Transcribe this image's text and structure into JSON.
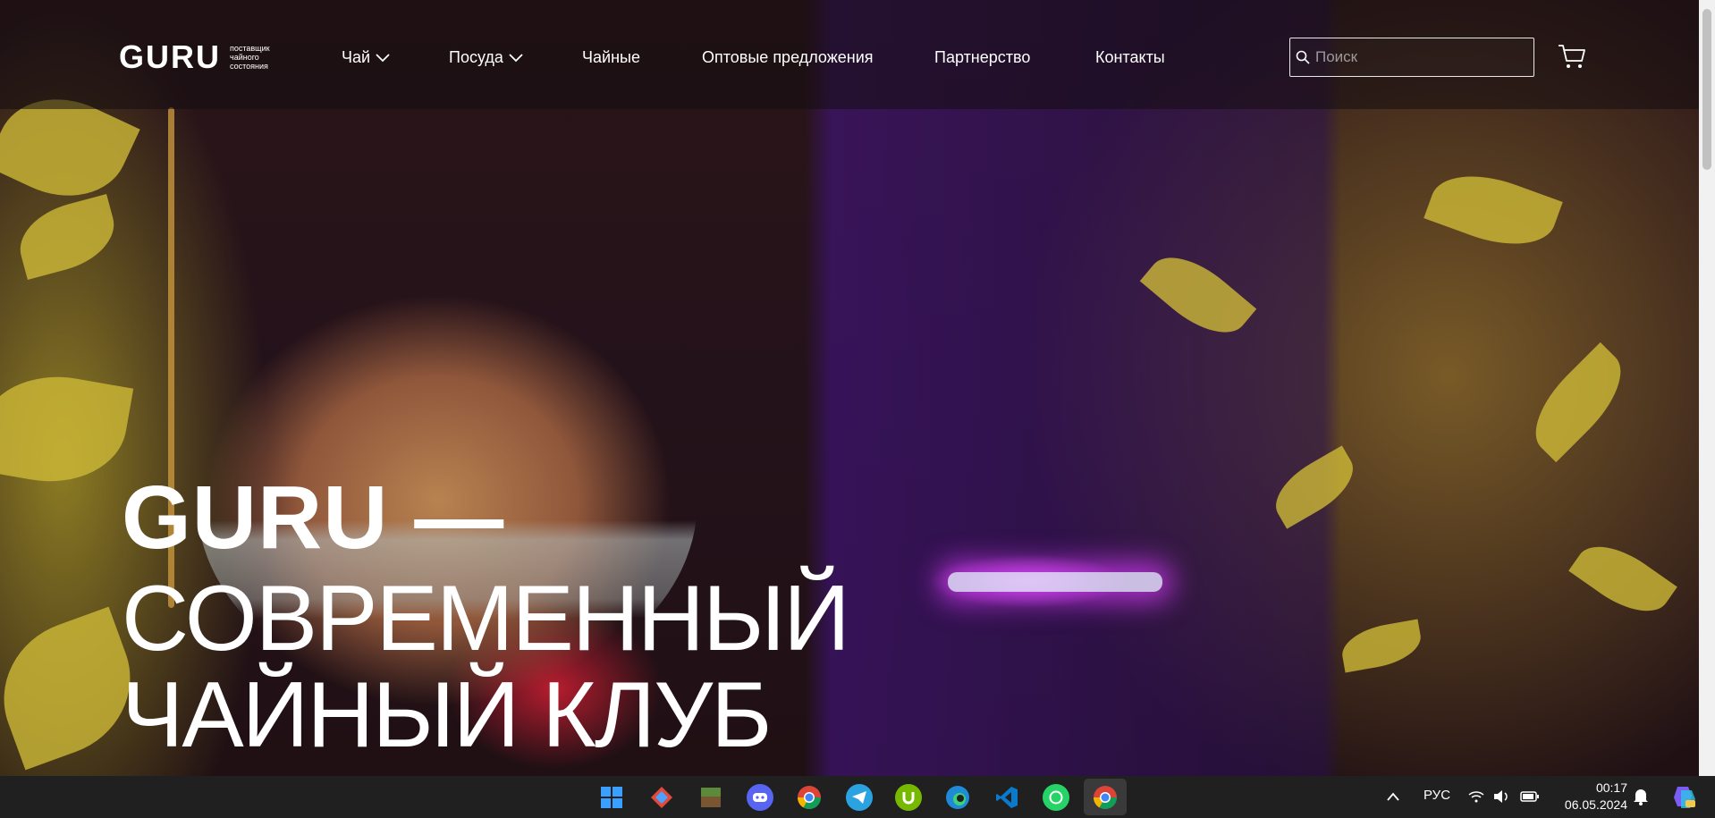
{
  "brand": {
    "name": "GURU",
    "tagline": "поставщик чайного состояния"
  },
  "nav": {
    "items": [
      {
        "label": "Чай",
        "has_dropdown": true
      },
      {
        "label": "Посуда",
        "has_dropdown": true
      },
      {
        "label": "Чайные",
        "has_dropdown": false
      },
      {
        "label": "Оптовые предложения",
        "has_dropdown": false
      },
      {
        "label": "Партнерство",
        "has_dropdown": false
      },
      {
        "label": "Контакты",
        "has_dropdown": false
      }
    ]
  },
  "search": {
    "placeholder": "Поиск",
    "value": ""
  },
  "cart": {
    "icon": "cart-icon"
  },
  "hero": {
    "line1": "GURU —",
    "line2": "СОВРЕМЕННЫЙ",
    "line3": "ЧАЙНЫЙ КЛУБ"
  },
  "taskbar": {
    "apps": [
      "windows-start",
      "git-tool",
      "minecraft",
      "discord",
      "chrome",
      "telegram",
      "utorrent",
      "edge",
      "vscode",
      "whatsapp",
      "chrome-active"
    ],
    "language": "РУС",
    "time": "00:17",
    "date": "06.05.2024"
  },
  "colors": {
    "header_bg": "#140c10",
    "taskbar_bg": "#202020",
    "text": "#ffffff"
  }
}
